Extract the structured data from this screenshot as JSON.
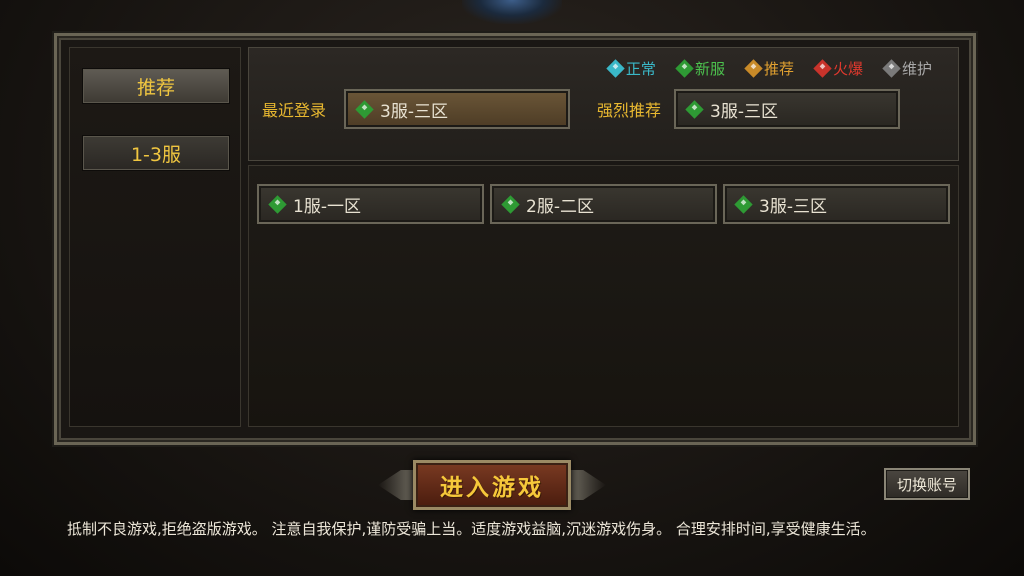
{
  "sidebar": {
    "tabs": [
      {
        "label": "推荐",
        "active": true
      },
      {
        "label": "1-3服",
        "active": false
      }
    ]
  },
  "legend": [
    {
      "label": "正常",
      "color": "#3ab8c8",
      "icon": "gem-normal-icon"
    },
    {
      "label": "新服",
      "color": "#2e9a34",
      "icon": "gem-new-icon"
    },
    {
      "label": "推荐",
      "color": "#c88a28",
      "icon": "gem-recommend-icon"
    },
    {
      "label": "火爆",
      "color": "#c8332b",
      "icon": "gem-hot-icon"
    },
    {
      "label": "维护",
      "color": "#7a7a7a",
      "icon": "gem-maintenance-icon"
    }
  ],
  "recent": {
    "label": "最近登录",
    "server": "3服-三区",
    "status": "new"
  },
  "strong_recommend": {
    "label": "强烈推荐",
    "server": "3服-三区",
    "status": "new"
  },
  "server_list": [
    {
      "name": "1服-一区",
      "status": "new"
    },
    {
      "name": "2服-二区",
      "status": "new"
    },
    {
      "name": "3服-三区",
      "status": "new"
    }
  ],
  "buttons": {
    "enter_game": "进入游戏",
    "switch_account": "切换账号"
  },
  "notice": "抵制不良游戏,拒绝盗版游戏。 注意自我保护,谨防受骗上当。适度游戏益脑,沉迷游戏伤身。 合理安排时间,享受健康生活。"
}
